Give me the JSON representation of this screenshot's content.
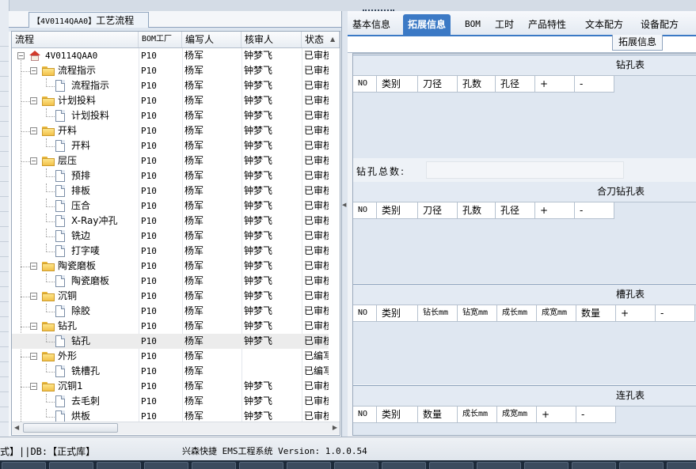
{
  "left_panel": {
    "tab_code": "【4V0114QAA0】",
    "tab_title": "工艺流程",
    "columns": [
      "流程",
      "BOM工厂",
      "编写人",
      "核审人",
      "状态"
    ],
    "rows": [
      {
        "name": "4V0114QAA0",
        "icon": "home-icon",
        "level": 0,
        "exp": "-",
        "bom": "P10",
        "writer": "杨军",
        "reviewer": "钟梦飞",
        "status": "已审核"
      },
      {
        "name": "流程指示",
        "icon": "folder-icon",
        "level": 1,
        "exp": "-",
        "bom": "P10",
        "writer": "杨军",
        "reviewer": "钟梦飞",
        "status": "已审核"
      },
      {
        "name": "流程指示",
        "icon": "document-icon",
        "level": 2,
        "exp": "",
        "bom": "P10",
        "writer": "杨军",
        "reviewer": "钟梦飞",
        "status": "已审核"
      },
      {
        "name": "计划投料",
        "icon": "folder-icon",
        "level": 1,
        "exp": "-",
        "bom": "P10",
        "writer": "杨军",
        "reviewer": "钟梦飞",
        "status": "已审核"
      },
      {
        "name": "计划投料",
        "icon": "document-icon",
        "level": 2,
        "exp": "",
        "bom": "P10",
        "writer": "杨军",
        "reviewer": "钟梦飞",
        "status": "已审核"
      },
      {
        "name": "开料",
        "icon": "folder-icon",
        "level": 1,
        "exp": "-",
        "bom": "P10",
        "writer": "杨军",
        "reviewer": "钟梦飞",
        "status": "已审核"
      },
      {
        "name": "开料",
        "icon": "document-icon",
        "level": 2,
        "exp": "",
        "bom": "P10",
        "writer": "杨军",
        "reviewer": "钟梦飞",
        "status": "已审核"
      },
      {
        "name": "层压",
        "icon": "folder-icon",
        "level": 1,
        "exp": "-",
        "bom": "P10",
        "writer": "杨军",
        "reviewer": "钟梦飞",
        "status": "已审核"
      },
      {
        "name": "预排",
        "icon": "document-icon",
        "level": 2,
        "exp": "",
        "bom": "P10",
        "writer": "杨军",
        "reviewer": "钟梦飞",
        "status": "已审核"
      },
      {
        "name": "排板",
        "icon": "document-icon",
        "level": 2,
        "exp": "",
        "bom": "P10",
        "writer": "杨军",
        "reviewer": "钟梦飞",
        "status": "已审核"
      },
      {
        "name": "压合",
        "icon": "document-icon",
        "level": 2,
        "exp": "",
        "bom": "P10",
        "writer": "杨军",
        "reviewer": "钟梦飞",
        "status": "已审核"
      },
      {
        "name": "X-Ray冲孔",
        "icon": "document-icon",
        "level": 2,
        "exp": "",
        "bom": "P10",
        "writer": "杨军",
        "reviewer": "钟梦飞",
        "status": "已审核"
      },
      {
        "name": "铣边",
        "icon": "document-icon",
        "level": 2,
        "exp": "",
        "bom": "P10",
        "writer": "杨军",
        "reviewer": "钟梦飞",
        "status": "已审核"
      },
      {
        "name": "打字唛",
        "icon": "document-icon",
        "level": 2,
        "exp": "",
        "bom": "P10",
        "writer": "杨军",
        "reviewer": "钟梦飞",
        "status": "已审核"
      },
      {
        "name": "陶瓷磨板",
        "icon": "folder-icon",
        "level": 1,
        "exp": "-",
        "bom": "P10",
        "writer": "杨军",
        "reviewer": "钟梦飞",
        "status": "已审核"
      },
      {
        "name": "陶瓷磨板",
        "icon": "document-icon",
        "level": 2,
        "exp": "",
        "bom": "P10",
        "writer": "杨军",
        "reviewer": "钟梦飞",
        "status": "已审核"
      },
      {
        "name": "沉铜",
        "icon": "folder-icon",
        "level": 1,
        "exp": "-",
        "bom": "P10",
        "writer": "杨军",
        "reviewer": "钟梦飞",
        "status": "已审核"
      },
      {
        "name": "除胶",
        "icon": "document-icon",
        "level": 2,
        "exp": "",
        "bom": "P10",
        "writer": "杨军",
        "reviewer": "钟梦飞",
        "status": "已审核"
      },
      {
        "name": "钻孔",
        "icon": "folder-icon",
        "level": 1,
        "exp": "-",
        "bom": "P10",
        "writer": "杨军",
        "reviewer": "钟梦飞",
        "status": "已审核"
      },
      {
        "name": "钻孔",
        "icon": "document-icon",
        "level": 2,
        "exp": "",
        "bom": "P10",
        "writer": "杨军",
        "reviewer": "钟梦飞",
        "status": "已审核",
        "selected": true
      },
      {
        "name": "外形",
        "icon": "folder-icon",
        "level": 1,
        "exp": "-",
        "bom": "P10",
        "writer": "杨军",
        "reviewer": "",
        "status": "已编写"
      },
      {
        "name": "铣槽孔",
        "icon": "document-icon",
        "level": 2,
        "exp": "",
        "bom": "P10",
        "writer": "杨军",
        "reviewer": "",
        "status": "已编写"
      },
      {
        "name": "沉铜1",
        "icon": "folder-icon",
        "level": 1,
        "exp": "-",
        "bom": "P10",
        "writer": "杨军",
        "reviewer": "钟梦飞",
        "status": "已审核"
      },
      {
        "name": "去毛刺",
        "icon": "document-icon",
        "level": 2,
        "exp": "",
        "bom": "P10",
        "writer": "杨军",
        "reviewer": "钟梦飞",
        "status": "已审核"
      },
      {
        "name": "烘板",
        "icon": "document-icon",
        "level": 2,
        "exp": "",
        "bom": "P10",
        "writer": "杨军",
        "reviewer": "钟梦飞",
        "status": "已审核"
      }
    ]
  },
  "right_panel": {
    "tabs": [
      "基本信息",
      "拓展信息",
      "BOM",
      "工时",
      "产品特性",
      "文本配方",
      "设备配方"
    ],
    "active_tab": 1,
    "subtab": "拓展信息",
    "sections": [
      {
        "title": "钻孔表",
        "columns": [
          "NO",
          "类别",
          "刀径",
          "孔数",
          "孔径",
          "+",
          "-"
        ]
      },
      {
        "title": "合刀钻孔表",
        "columns": [
          "NO",
          "类别",
          "刀径",
          "孔数",
          "孔径",
          "+",
          "-"
        ]
      },
      {
        "title": "槽孔表",
        "columns": [
          "NO",
          "类别",
          "钻长mm",
          "钻宽mm",
          "成长mm",
          "成宽mm",
          "数量",
          "+",
          "-"
        ]
      },
      {
        "title": "连孔表",
        "columns": [
          "NO",
          "类别",
          "数量",
          "成长mm",
          "成宽mm",
          "+",
          "-"
        ]
      }
    ],
    "drill_total_label": "钻孔总数:",
    "drill_total_value": ""
  },
  "status_bar": {
    "left": "式】||DB:【正式库】",
    "center": "兴森快捷 EMS工程系统 Version: 1.0.0.54"
  },
  "colors": {
    "accent": "#3b79c5",
    "folder": "#f2c14a",
    "home": "#d23a2a"
  }
}
